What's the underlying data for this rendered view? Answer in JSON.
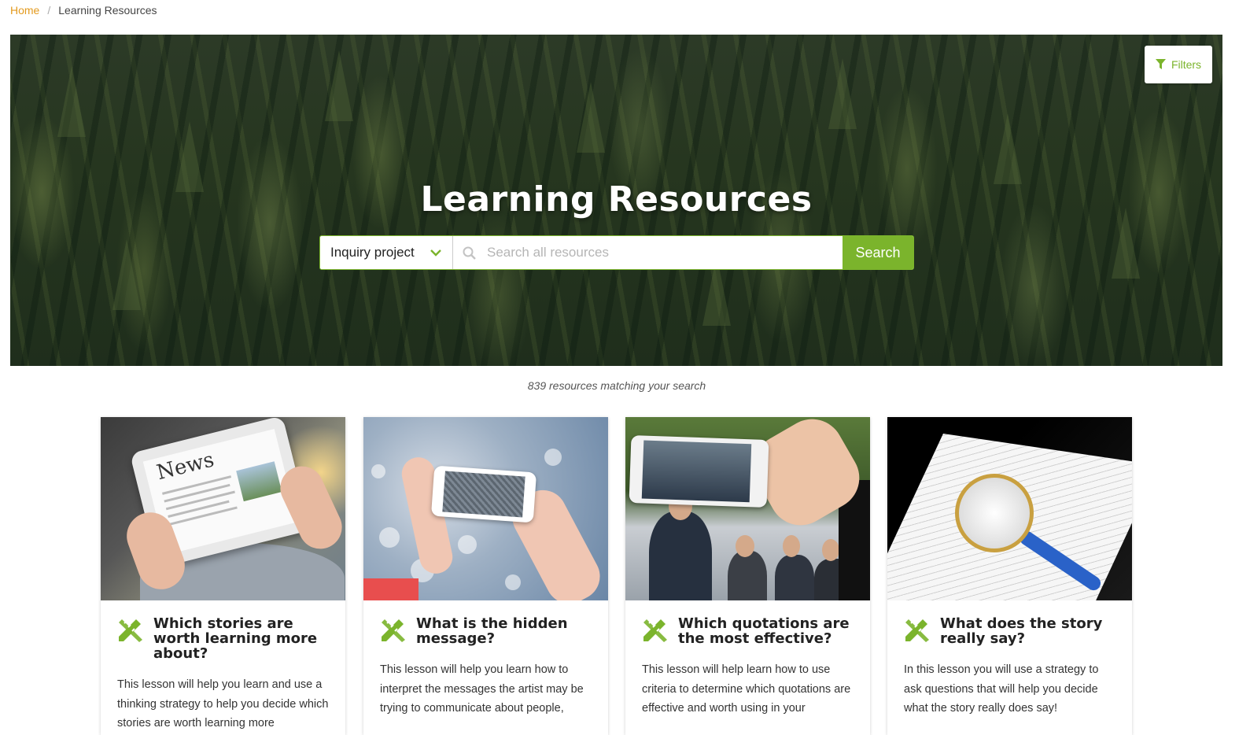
{
  "breadcrumb": {
    "home": "Home",
    "separator": "/",
    "current": "Learning Resources"
  },
  "hero": {
    "title": "Learning Resources"
  },
  "filters": {
    "label": "Filters",
    "icon": "filter-icon"
  },
  "search": {
    "category_selected": "Inquiry project",
    "placeholder": "Search all resources",
    "value": "",
    "button_label": "Search"
  },
  "results": {
    "count_text": "839 resources matching your search"
  },
  "colors": {
    "accent": "#7bb42c",
    "breadcrumb_home": "#e39a1e"
  },
  "cards": [
    {
      "icon": "pencil-ruler-icon",
      "image": "tablet-news-image",
      "title": "Which stories are worth learning more about?",
      "description": "This lesson will help you learn and use a thinking strategy to help you decide which stories are worth learning more",
      "image_text": "News"
    },
    {
      "icon": "pencil-ruler-icon",
      "image": "phone-photo-image",
      "title": "What is the hidden message?",
      "description": "This lesson will help you learn how to interpret the messages the artist may be trying to communicate about people,"
    },
    {
      "icon": "pencil-ruler-icon",
      "image": "phone-speaker-image",
      "title": "Which quotations are the most effective?",
      "description": "This lesson will help learn how to use criteria to determine which quotations are effective and worth using in your"
    },
    {
      "icon": "pencil-ruler-icon",
      "image": "magnifier-newspaper-image",
      "title": "What does the story really say?",
      "description": "In this lesson you will use a strategy to ask questions that will help you decide what the story really does say!"
    }
  ]
}
